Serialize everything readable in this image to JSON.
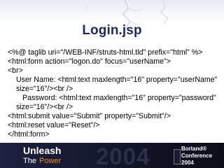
{
  "slide": {
    "title": "Login.jsp",
    "code_lines": [
      "<%@ taglib uri=\"/WEB-INF/struts-html.tld\" prefix=\"html\" %>",
      "<html:form action=\"logon.do\" focus=\"userName\">",
      "<br>",
      "User Name: <html:text maxlength=\"16\" property=\"userName\"",
      "size=\"16\"/><br />",
      "Password: <html:text maxlength=\"16\" property=\"password\"",
      "size=\"16\"/><br />",
      "<html:submit value=\"Submit\" property=\"Submit\"/>",
      "<html:reset value=\"Reset\"/>",
      "</html:form>"
    ]
  },
  "footer": {
    "tagline_top": "Unleash",
    "tagline_the": "The",
    "tagline_power": "Power",
    "year": "2004",
    "logo_brand": "Borland®",
    "logo_event": "Conference",
    "logo_year": "2004"
  },
  "colors": {
    "title": "#1a2c63",
    "footer_bg": "#121425",
    "power_accent": "#f08a1c"
  }
}
